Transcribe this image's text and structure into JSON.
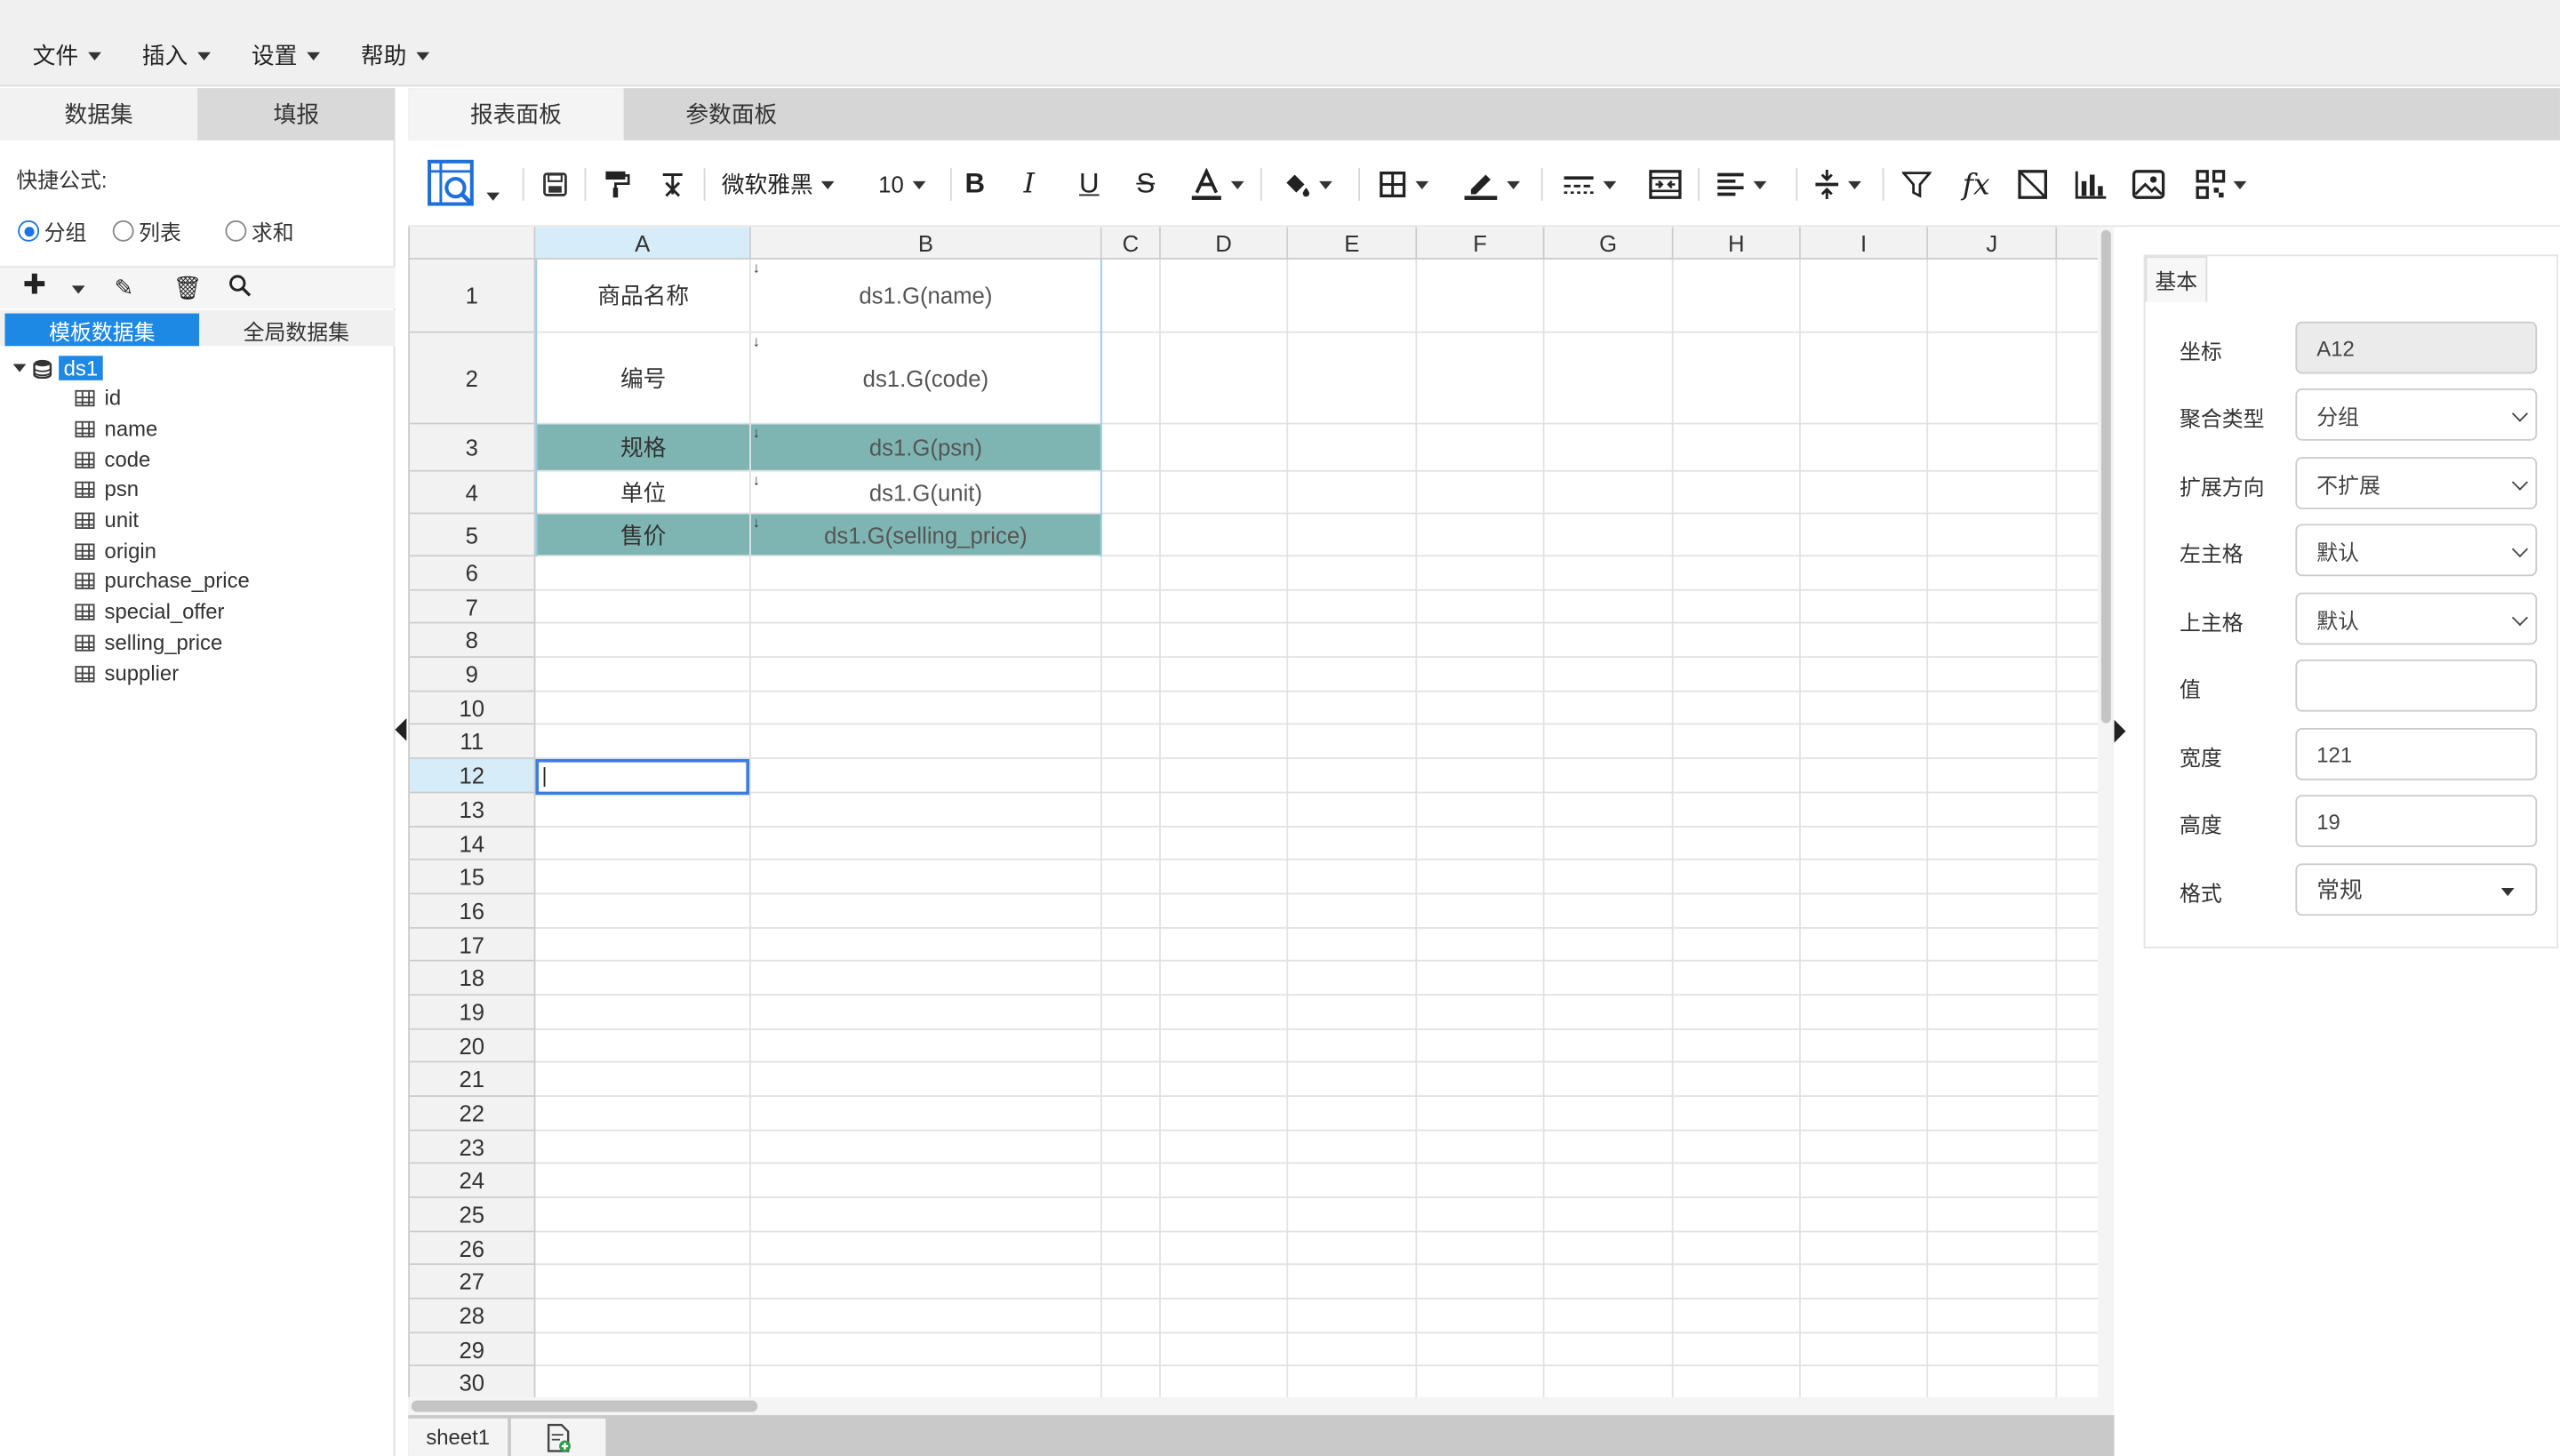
{
  "menubar": {
    "items": [
      "文件",
      "插入",
      "设置",
      "帮助"
    ]
  },
  "left_panel": {
    "tabs": [
      "数据集",
      "填报"
    ],
    "quick_formula_label": "快捷公式:",
    "radio_options": [
      "分组",
      "列表",
      "求和"
    ],
    "selected_radio": "分组",
    "dataset_tabs": [
      "模板数据集",
      "全局数据集"
    ],
    "tree": {
      "root": "ds1",
      "fields": [
        "id",
        "name",
        "code",
        "psn",
        "unit",
        "origin",
        "purchase_price",
        "special_offer",
        "selling_price",
        "supplier"
      ]
    }
  },
  "center": {
    "tabs": [
      "报表面板",
      "参数面板"
    ],
    "toolbar": {
      "font_name": "微软雅黑",
      "font_size": "10",
      "fx_label": "fx"
    }
  },
  "sheet": {
    "columns": [
      "A",
      "B",
      "C",
      "D",
      "E",
      "F",
      "G",
      "H",
      "I",
      "J"
    ],
    "selected_column": "A",
    "rows": [
      "1",
      "2",
      "3",
      "4",
      "5",
      "6",
      "7",
      "8",
      "9",
      "10",
      "11",
      "12",
      "13",
      "14",
      "15",
      "16",
      "17",
      "18",
      "19",
      "20",
      "21",
      "22",
      "23",
      "24",
      "25",
      "26",
      "27",
      "28",
      "29",
      "30"
    ],
    "selected_row": "12",
    "cells": {
      "a1": "商品名称",
      "b1": "ds1.G(name)",
      "a2": "编号",
      "b2": "ds1.G(code)",
      "a3": "规格",
      "b3": "ds1.G(psn)",
      "a4": "单位",
      "b4": "ds1.G(unit)",
      "a5": "售价",
      "b5": "ds1.G(selling_price)"
    },
    "expand_marker": "↓",
    "highlight_color": "#7eb5b3",
    "sheet_tabs": [
      "sheet1"
    ]
  },
  "properties": {
    "tab": "基本",
    "fields": [
      {
        "label": "坐标",
        "value": "A12"
      },
      {
        "label": "聚合类型",
        "value": "分组"
      },
      {
        "label": "扩展方向",
        "value": "不扩展"
      },
      {
        "label": "左主格",
        "value": "默认"
      },
      {
        "label": "上主格",
        "value": "默认"
      },
      {
        "label": "值",
        "value": ""
      },
      {
        "label": "宽度",
        "value": "121"
      },
      {
        "label": "高度",
        "value": "19"
      },
      {
        "label": "格式",
        "value": "常规"
      }
    ]
  },
  "colors": {
    "accent": "#1e88e5",
    "selection_border": "#3b7de0",
    "header_selected": "#d6ecf8"
  }
}
